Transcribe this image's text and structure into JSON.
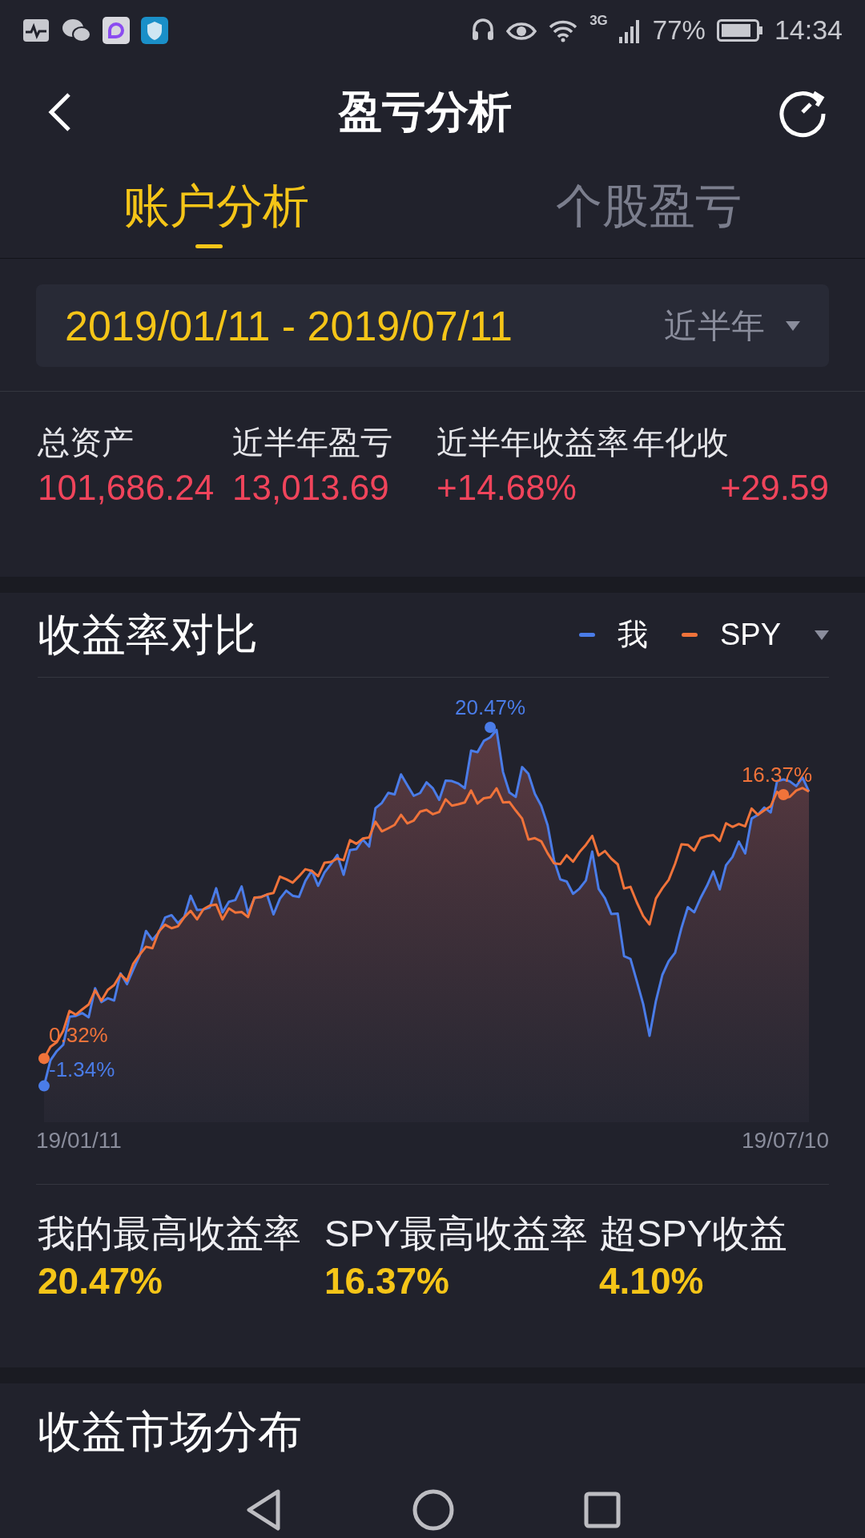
{
  "status_bar": {
    "network": "3G",
    "battery": "77%",
    "time": "14:34"
  },
  "header": {
    "title": "盈亏分析"
  },
  "tabs": [
    {
      "label": "账户分析",
      "selected": true
    },
    {
      "label": "个股盈亏",
      "selected": false
    }
  ],
  "date_range": {
    "range": "2019/01/11 - 2019/07/11",
    "period": "近半年"
  },
  "summary": [
    {
      "label": "总资产",
      "value": "101,686.24"
    },
    {
      "label": "近半年盈亏",
      "value": "13,013.69"
    },
    {
      "label": "近半年收益率",
      "value": "+14.68%"
    },
    {
      "label": "年化收",
      "value": "+29.59"
    }
  ],
  "comparison": {
    "title": "收益率对比",
    "legend": [
      {
        "name": "我",
        "color": "#4a7ce8",
        "peak_label": "20.47%"
      },
      {
        "name": "SPY",
        "color": "#f0733a",
        "peak_label": "16.37%"
      }
    ],
    "chart": {
      "start_values": [
        {
          "text": "0.32%",
          "color": "#f0733a"
        },
        {
          "text": "-1.34%",
          "color": "#4a7ce8"
        }
      ],
      "start_label": "19/01/11",
      "end_label": "19/07/10"
    }
  },
  "highlights": [
    {
      "label": "我的最高收益率",
      "value": "20.47%"
    },
    {
      "label": "SPY最高收益率",
      "value": "16.37%"
    },
    {
      "label": "超SPY收益",
      "value": "4.10%"
    }
  ],
  "next_section": {
    "title": "收益市场分布"
  }
}
